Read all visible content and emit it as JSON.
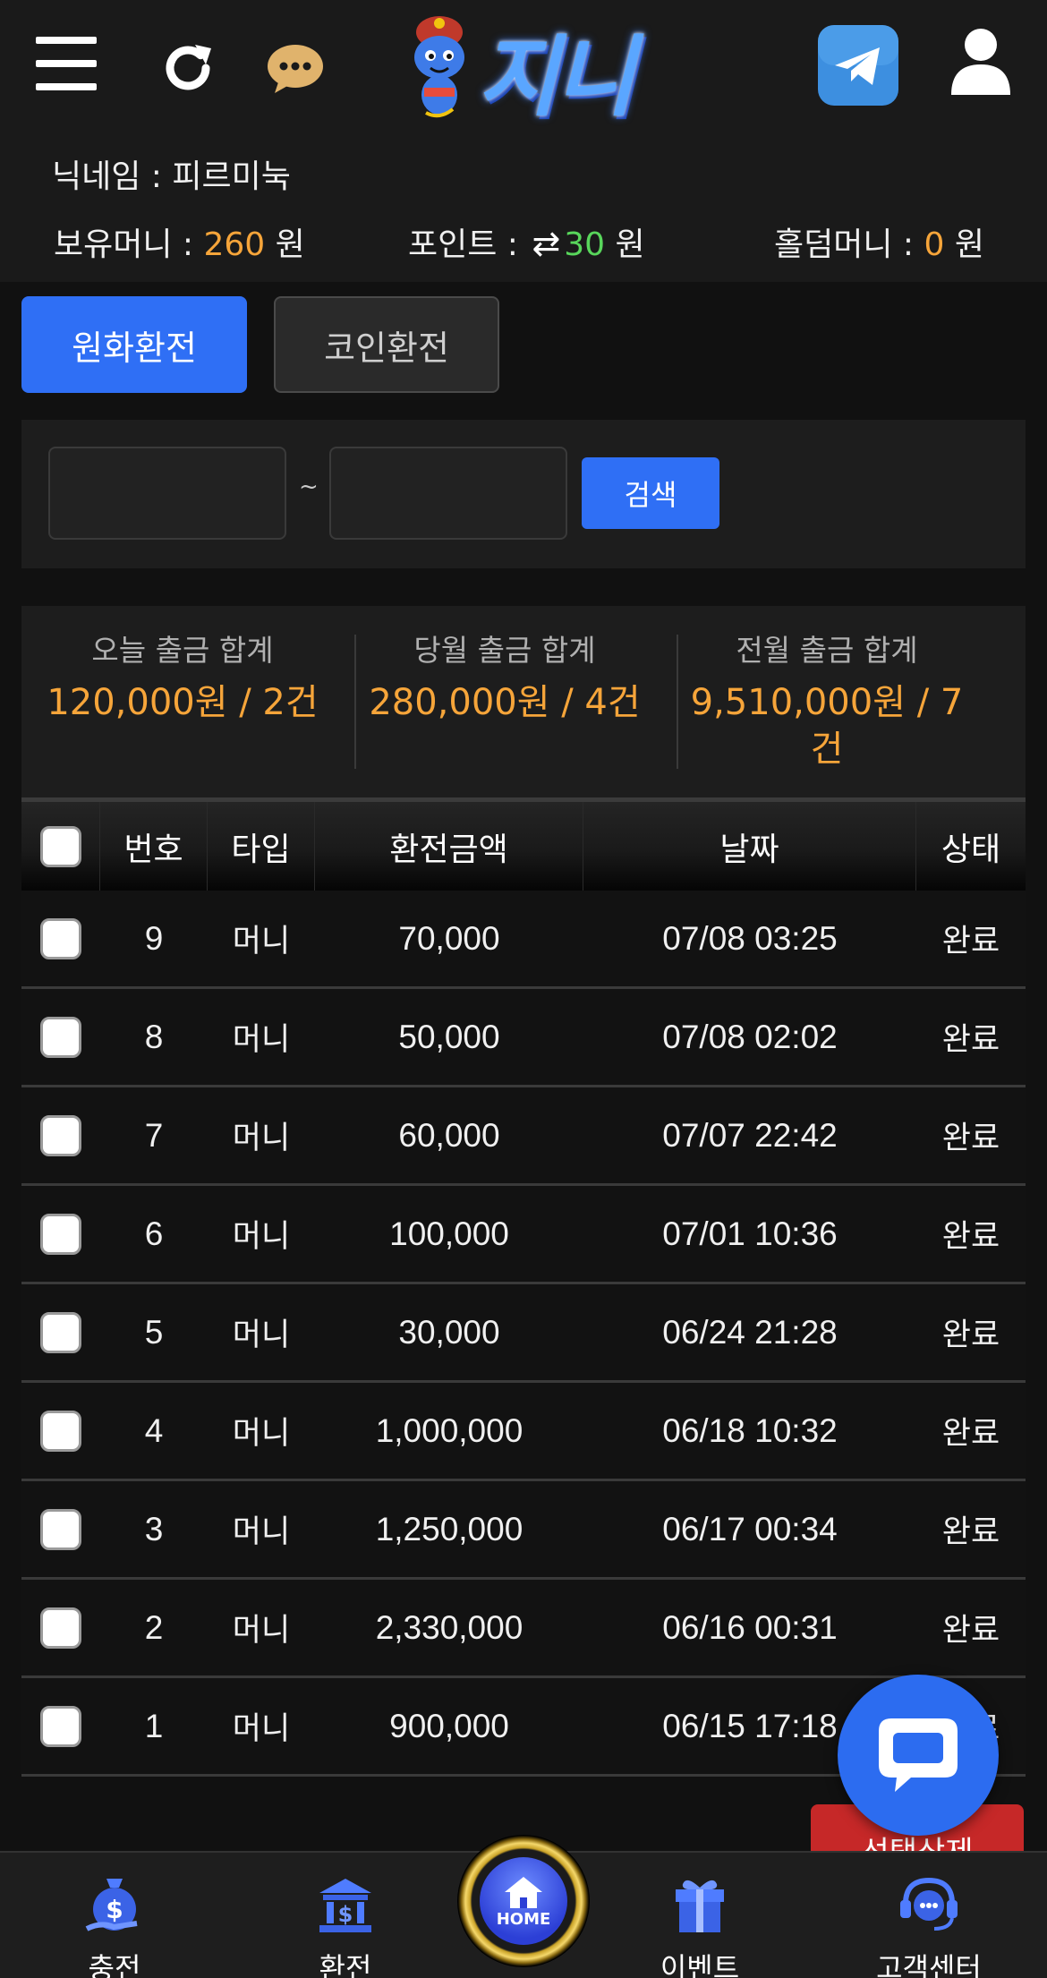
{
  "header": {
    "logo_text": "지니",
    "nickname_label": "닉네임 : ",
    "nickname": "피르미눅",
    "money_label": "보유머니 : ",
    "money_value": "260",
    "point_label": "포인트 : ",
    "point_value": "30",
    "holdem_label": "홀덤머니 : ",
    "holdem_value": "0",
    "unit": "원",
    "icons": [
      "menu-icon",
      "refresh-icon",
      "chat-icon",
      "telegram-icon",
      "user-icon"
    ]
  },
  "tabs": [
    {
      "label": "원화환전",
      "active": true
    },
    {
      "label": "코인환전",
      "active": false
    }
  ],
  "search": {
    "date_from": "",
    "date_to": "",
    "separator": "~",
    "button": "검색"
  },
  "summary": [
    {
      "label": "오늘 출금 합계",
      "value": "120,000원 / 2건"
    },
    {
      "label": "당월 출금 합계",
      "value": "280,000원 / 4건"
    },
    {
      "label": "전월 출금 합계",
      "value": "9,510,000원 / 7건"
    }
  ],
  "table": {
    "headers": [
      "번호",
      "타입",
      "환전금액",
      "날짜",
      "상태"
    ],
    "rows": [
      {
        "no": "9",
        "type": "머니",
        "amount": "70,000",
        "date": "07/08 03:25",
        "status": "완료"
      },
      {
        "no": "8",
        "type": "머니",
        "amount": "50,000",
        "date": "07/08 02:02",
        "status": "완료"
      },
      {
        "no": "7",
        "type": "머니",
        "amount": "60,000",
        "date": "07/07 22:42",
        "status": "완료"
      },
      {
        "no": "6",
        "type": "머니",
        "amount": "100,000",
        "date": "07/01 10:36",
        "status": "완료"
      },
      {
        "no": "5",
        "type": "머니",
        "amount": "30,000",
        "date": "06/24 21:28",
        "status": "완료"
      },
      {
        "no": "4",
        "type": "머니",
        "amount": "1,000,000",
        "date": "06/18 10:32",
        "status": "완료"
      },
      {
        "no": "3",
        "type": "머니",
        "amount": "1,250,000",
        "date": "06/17 00:34",
        "status": "완료"
      },
      {
        "no": "2",
        "type": "머니",
        "amount": "2,330,000",
        "date": "06/16 00:31",
        "status": "완료"
      },
      {
        "no": "1",
        "type": "머니",
        "amount": "900,000",
        "date": "06/15 17:18",
        "status": "완료"
      }
    ]
  },
  "actions": {
    "delete_selected": "선택삭제"
  },
  "bottom_nav": {
    "charge": "충전",
    "exchange": "환전",
    "home": "HOME",
    "event": "이벤트",
    "support": "고객센터"
  },
  "colors": {
    "accent_blue": "#2f6ff5",
    "amount_orange": "#f6a53a",
    "point_green": "#58d65b",
    "delete_red": "#c62828"
  }
}
